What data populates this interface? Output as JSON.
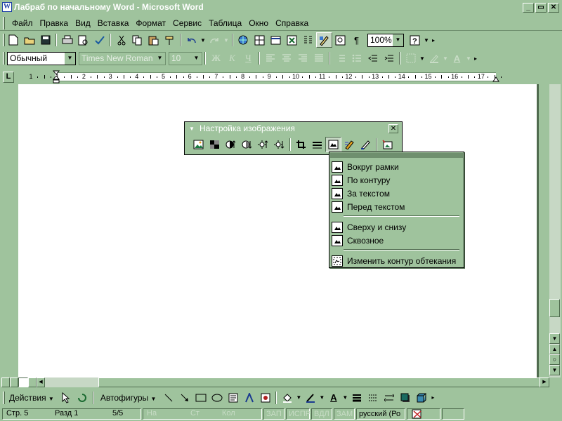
{
  "window": {
    "title": "Лабраб по начальному Word - Microsoft Word",
    "minimize": "_",
    "restore": "▭",
    "close": "✕"
  },
  "menu": [
    "Файл",
    "Правка",
    "Вид",
    "Вставка",
    "Формат",
    "Сервис",
    "Таблица",
    "Окно",
    "Справка"
  ],
  "toolbar": {
    "zoom": "100%",
    "paragraph_mark": "¶"
  },
  "format_bar": {
    "style": "Обычный",
    "font": "Times New Roman",
    "size": "10",
    "bold": "Ж",
    "italic": "К",
    "underline": "Ч"
  },
  "ruler": {
    "ticks": [
      "1",
      "1",
      "2",
      "3",
      "4",
      "5",
      "6",
      "7",
      "8",
      "9",
      "10",
      "11",
      "12",
      "13",
      "14",
      "15",
      "16",
      "17"
    ]
  },
  "picture_toolbar": {
    "title": "Настройка изображения",
    "close": "✕"
  },
  "wrap_menu": {
    "items": [
      "Вокруг рамки",
      "По контуру",
      "За текстом",
      "Перед текстом",
      "Сверху и снизу",
      "Сквозное",
      "Изменить контур обтекания"
    ]
  },
  "draw_bar": {
    "actions": "Действия",
    "autoshapes": "Автофигуры"
  },
  "status": {
    "page": "Стр. 5",
    "section": "Разд 1",
    "pages": "5/5",
    "at": "На",
    "line": "Ст",
    "col": "Кол",
    "rec": "ЗАП",
    "trk": "ИСПР",
    "ext": "ВДЛ",
    "ovr": "ЗАМ",
    "language": "русский (Ро"
  },
  "colors": {
    "chrome": "#9fc39d",
    "document": "#ffffff",
    "highlight_border": "#4f6b4e"
  }
}
